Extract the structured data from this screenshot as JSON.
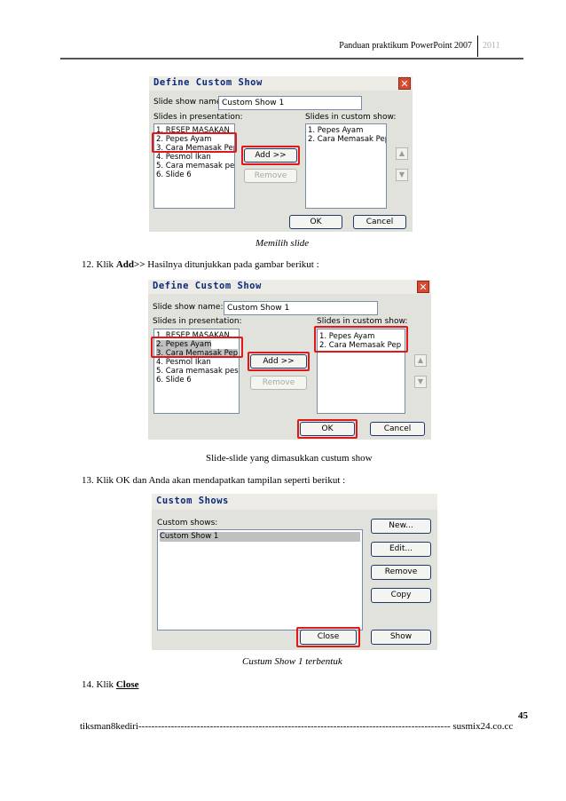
{
  "header": {
    "text": "Panduan praktikum PowerPoint 2007",
    "year": "2011"
  },
  "dialog1": {
    "title": "Define Custom Show",
    "name_label": "Slide show name:",
    "name_value": "Custom Show 1",
    "left_label": "Slides in presentation:",
    "right_label": "Slides in custom show:",
    "left_items": [
      "1. RESEP MASAKAN",
      "2. Pepes Ayam",
      "3. Cara Memasak Pep",
      "4. Pesmol Ikan",
      "5. Cara memasak pes",
      "6. Slide 6"
    ],
    "right_items": [
      "1. Pepes Ayam",
      "2. Cara Memasak Pep"
    ],
    "add": "Add >>",
    "remove": "Remove",
    "ok": "OK",
    "cancel": "Cancel",
    "up_arrow": "▲",
    "down_arrow": "▼",
    "close": "✕"
  },
  "caption1": "Memilih slide",
  "step12": {
    "prefix": "12. Klik ",
    "bold": "Add>>",
    "rest": "  Hasilnya ditunjukkan pada gambar berikut :"
  },
  "dialog2": {
    "title": "Define Custom Show",
    "name_label": "Slide show name:",
    "name_value": "Custom Show 1",
    "left_label": "Slides in presentation:",
    "right_label": "Slides in custom show:",
    "left_items": [
      "1. RESEP MASAKAN",
      "2. Pepes Ayam",
      "3. Cara Memasak Pep",
      "4. Pesmol Ikan",
      "5. Cara memasak pes",
      "6. Slide 6"
    ],
    "right_items": [
      "1. Pepes Ayam",
      "2. Cara Memasak Pep"
    ],
    "add": "Add >>",
    "remove": "Remove",
    "ok": "OK",
    "cancel": "Cancel",
    "up_arrow": "▲",
    "down_arrow": "▼",
    "close": "✕"
  },
  "caption2": "Slide-slide yang dimasukkan custum show",
  "step13": "13. Klik OK dan Anda akan mendapatkan tampilan seperti berikut :",
  "dialog3": {
    "title": "Custom Shows",
    "list_label": "Custom shows:",
    "items": [
      "Custom Show 1"
    ],
    "new": "New...",
    "edit": "Edit...",
    "remove": "Remove",
    "copy": "Copy",
    "close": "Close",
    "show": "Show"
  },
  "caption3": "Custum Show 1 terbentuk",
  "step14": {
    "prefix": "14. Klik ",
    "bold": "Close"
  },
  "footer": {
    "page_number": "45",
    "text": "tiksman8kediri------------------------------------------------------------------------------------------------ susmix24.co.cc"
  }
}
